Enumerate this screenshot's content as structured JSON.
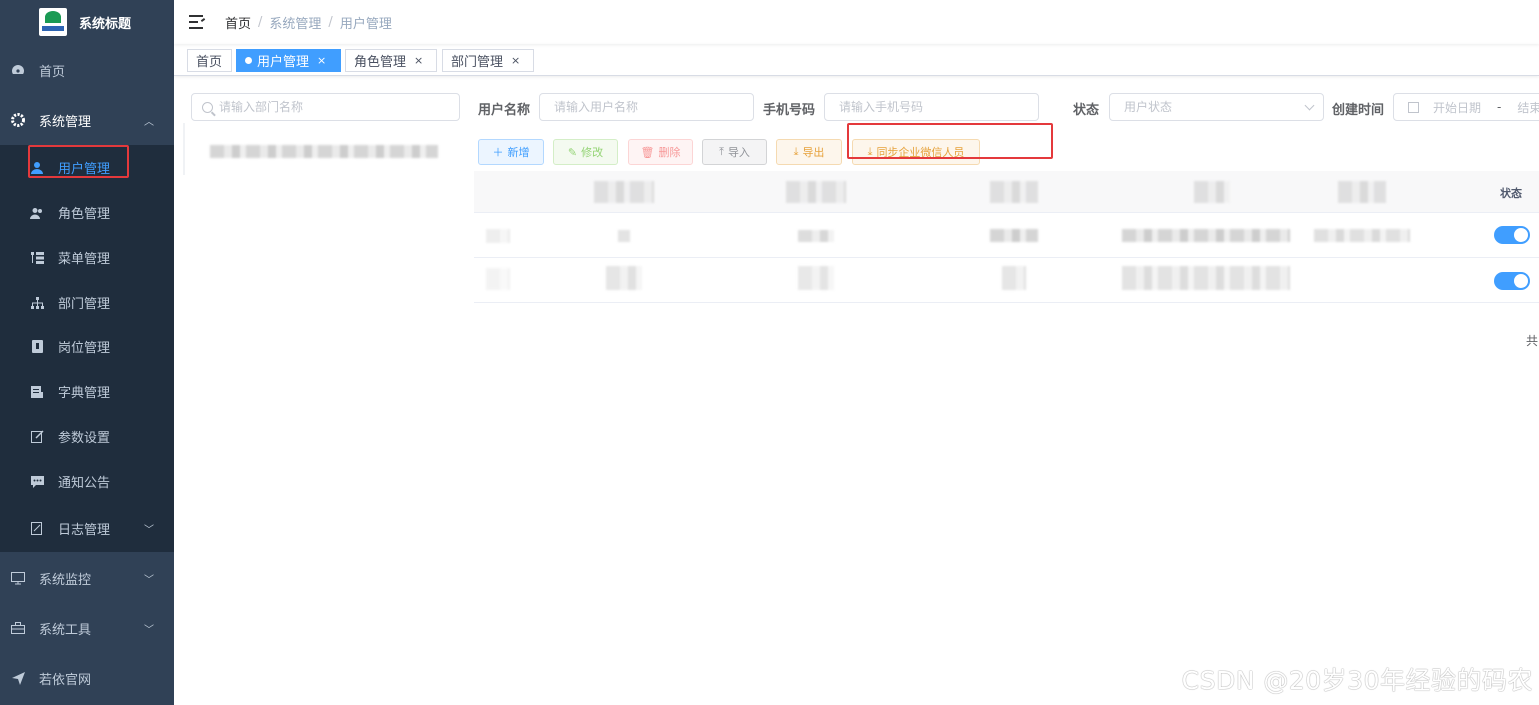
{
  "sidebar": {
    "logo_title": "系统标题",
    "items": [
      {
        "label": "首页",
        "icon": "dashboard-icon"
      },
      {
        "label": "系统管理",
        "icon": "gear-icon"
      },
      {
        "label": "用户管理",
        "icon": "user-icon"
      },
      {
        "label": "角色管理",
        "icon": "peoples-icon"
      },
      {
        "label": "菜单管理",
        "icon": "tree-table-icon"
      },
      {
        "label": "部门管理",
        "icon": "tree-icon"
      },
      {
        "label": "岗位管理",
        "icon": "post-icon"
      },
      {
        "label": "字典管理",
        "icon": "dict-icon"
      },
      {
        "label": "参数设置",
        "icon": "edit-icon"
      },
      {
        "label": "通知公告",
        "icon": "message-icon"
      },
      {
        "label": "日志管理",
        "icon": "log-icon"
      },
      {
        "label": "系统监控",
        "icon": "monitor-icon"
      },
      {
        "label": "系统工具",
        "icon": "tool-icon"
      },
      {
        "label": "若依官网",
        "icon": "guide-icon"
      }
    ]
  },
  "breadcrumb": [
    "首页",
    "系统管理",
    "用户管理"
  ],
  "tags": [
    {
      "label": "首页"
    },
    {
      "label": "用户管理",
      "close": "×"
    },
    {
      "label": "角色管理",
      "close": "×"
    },
    {
      "label": "部门管理",
      "close": "×"
    }
  ],
  "dept_search": {
    "placeholder": "请输入部门名称"
  },
  "filters": {
    "username": {
      "label": "用户名称",
      "placeholder": "请输入用户名称"
    },
    "phone": {
      "label": "手机号码",
      "placeholder": "请输入手机号码"
    },
    "status": {
      "label": "状态",
      "placeholder": "用户状态"
    },
    "created": {
      "label": "创建时间",
      "start": "开始日期",
      "sep": "-",
      "end": "结束"
    }
  },
  "actions": {
    "add": "新增",
    "edit": "修改",
    "delete": "删除",
    "import": "导入",
    "export": "导出",
    "sync": "同步企业微信人员"
  },
  "table": {
    "status_header": "状态",
    "rows": [
      {
        "status_on": true
      },
      {
        "status_on": true
      }
    ]
  },
  "pagination": {
    "total_prefix": "共"
  },
  "watermark": "CSDN @20岁30年经验的码农",
  "colors": {
    "sidebar_bg": "#304156",
    "accent": "#409eff",
    "highlight": "#e4393c"
  }
}
